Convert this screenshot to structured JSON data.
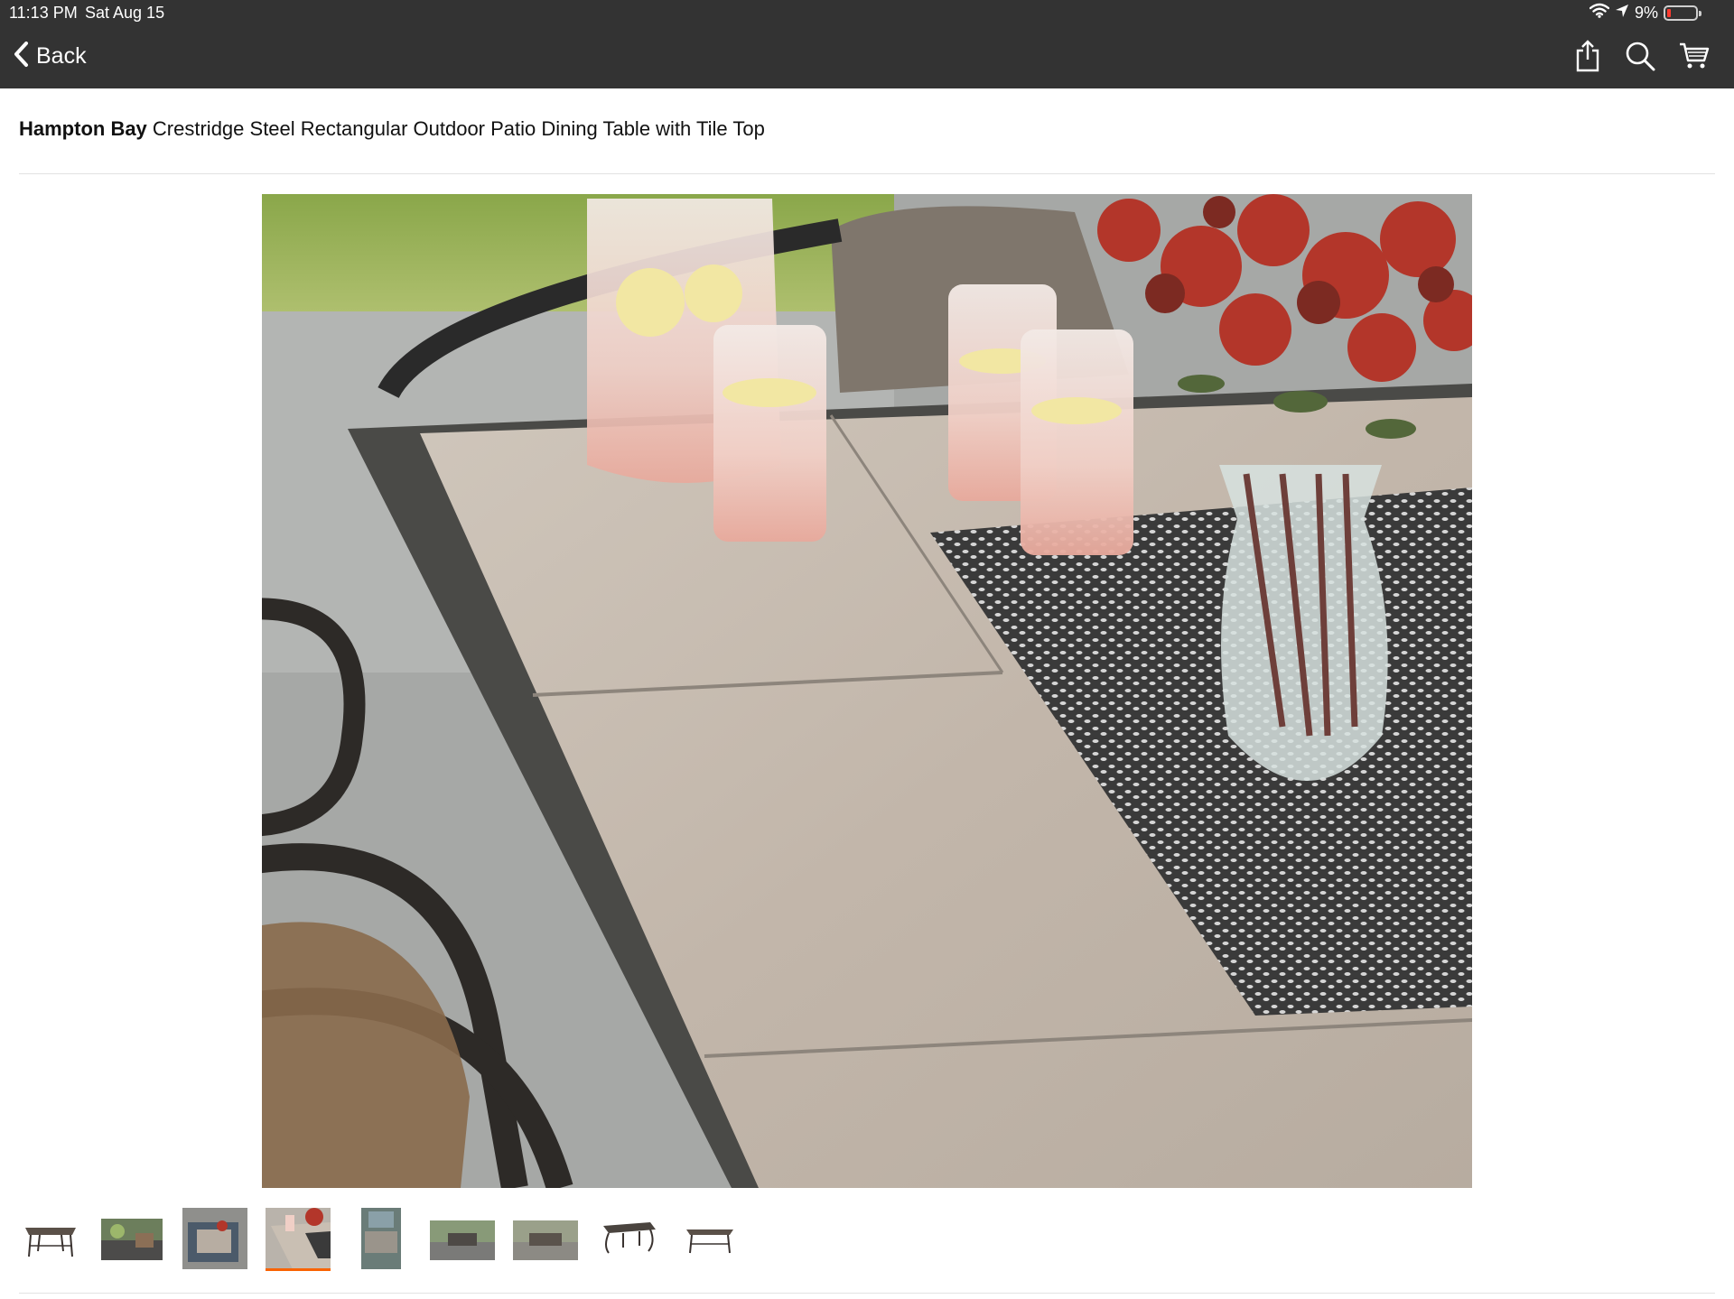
{
  "status_bar": {
    "time": "11:13 PM",
    "date": "Sat Aug 15",
    "battery_percent": "9%",
    "battery_level": 0.09,
    "icons": [
      "wifi-icon",
      "location-arrow-icon",
      "battery-icon"
    ]
  },
  "nav": {
    "back_label": "Back",
    "actions": [
      "share-icon",
      "search-icon",
      "cart-icon"
    ]
  },
  "product": {
    "brand": "Hampton Bay",
    "name": "Crestridge Steel Rectangular Outdoor Patio Dining Table with Tile Top"
  },
  "gallery": {
    "selected_index": 3,
    "thumbnail_count": 9,
    "accent_color": "#f96302"
  },
  "colors": {
    "header_bg": "#333333",
    "accent": "#f96302",
    "battery_low": "#ff3b30"
  }
}
